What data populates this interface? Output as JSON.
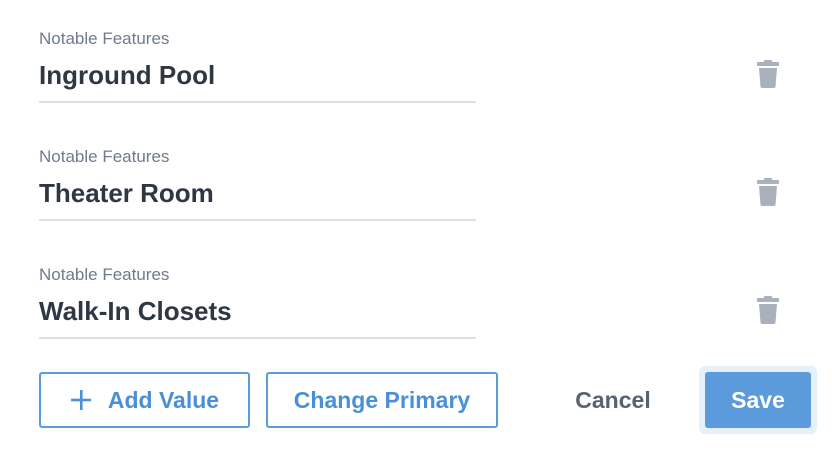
{
  "fields": [
    {
      "label": "Notable Features",
      "value": "Inground Pool"
    },
    {
      "label": "Notable Features",
      "value": "Theater Room"
    },
    {
      "label": "Notable Features",
      "value": "Walk-In Closets"
    }
  ],
  "icons": {
    "delete": "trash-icon",
    "add": "plus-icon"
  },
  "actions": {
    "add_value_label": "Add Value",
    "change_primary_label": "Change Primary",
    "cancel_label": "Cancel",
    "save_label": "Save"
  },
  "colors": {
    "accent": "#5b9bdc",
    "label_text": "#6f7b8d",
    "value_text": "#2f3744",
    "icon_muted": "#a9b1bc",
    "divider": "#dde1e6"
  }
}
